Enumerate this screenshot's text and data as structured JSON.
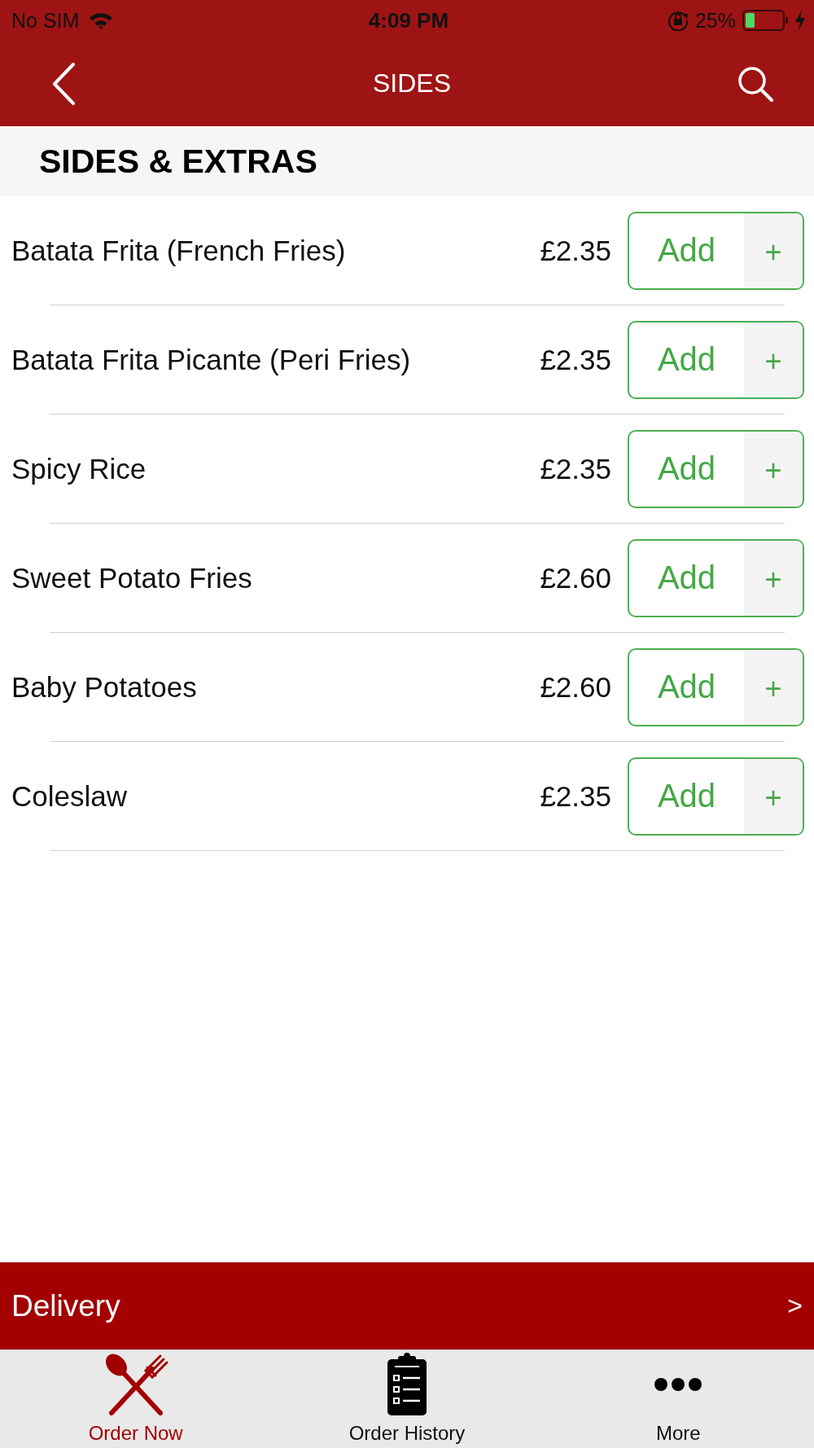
{
  "status_bar": {
    "carrier": "No SIM",
    "time": "4:09 PM",
    "battery": "25%"
  },
  "nav": {
    "title": "SIDES"
  },
  "section": {
    "title": "SIDES & EXTRAS"
  },
  "items": [
    {
      "name": "Batata Frita (French Fries)",
      "price": "£2.35",
      "button": "Add",
      "button_plus": "+"
    },
    {
      "name": "Batata Frita Picante (Peri Fries)",
      "price": "£2.35",
      "button": "Add",
      "button_plus": "+"
    },
    {
      "name": "Spicy Rice",
      "price": "£2.35",
      "button": "Add",
      "button_plus": "+"
    },
    {
      "name": "Sweet Potato Fries",
      "price": "£2.60",
      "button": "Add",
      "button_plus": "+"
    },
    {
      "name": "Baby Potatoes",
      "price": "£2.60",
      "button": "Add",
      "button_plus": "+"
    },
    {
      "name": "Coleslaw",
      "price": "£2.35",
      "button": "Add",
      "button_plus": "+"
    }
  ],
  "delivery_bar": {
    "label": "Delivery",
    "arrow": ">"
  },
  "tabs": [
    {
      "label": "Order Now",
      "selected": true
    },
    {
      "label": "Order History",
      "selected": false
    },
    {
      "label": "More",
      "selected": false
    }
  ]
}
